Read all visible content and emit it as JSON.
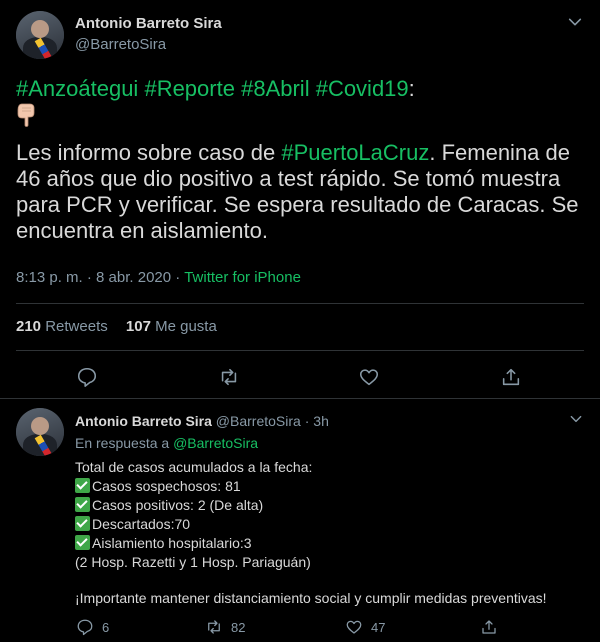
{
  "main_tweet": {
    "author_name": "Antonio Barreto Sira",
    "author_handle": "@BarretoSira",
    "hashtags_line": [
      "#Anzoátegui",
      "#Reporte",
      "#8Abril",
      "#Covid19"
    ],
    "hashtag_suffix": ":",
    "body_prefix": "Les informo sobre caso de ",
    "body_tag": "#PuertoLaCruz",
    "body_rest_1": ". Femenina de",
    "body_line_2": "46 años que dio positivo a test rápido. Se tomó muestra",
    "body_line_3": "para PCR y verificar. Se espera resultado de Caracas. Se",
    "body_line_4": "encuentra en aislamiento.",
    "time": "8:13 p. m.",
    "separator": "·",
    "date": "8 abr. 2020",
    "source": "Twitter for iPhone",
    "retweets_count": "210",
    "retweets_label": "Retweets",
    "likes_count": "107",
    "likes_label": "Me gusta"
  },
  "reply_tweet": {
    "author_name": "Antonio Barreto Sira",
    "author_handle": "@BarretoSira",
    "time_ago": "3h",
    "reply_prefix": "En respuesta a",
    "reply_handle": "@BarretoSira",
    "line_total": "Total de casos acumulados a la fecha:",
    "line_suspected": "Casos sospechosos: 81",
    "line_positive": "Casos positivos: 2 (De alta)",
    "line_discarded": "Descartados:70",
    "line_isolation": "Aislamiento hospitalario:3",
    "line_hospitals": "(2 Hosp. Razetti y 1 Hosp. Pariaguán)",
    "line_important": "¡Importante mantener distanciamiento social y cumplir medidas preventivas!",
    "replies": "6",
    "retweets": "82",
    "likes": "47"
  },
  "colors": {
    "background": "#000000",
    "hashtag": "#17bf63",
    "secondary": "#8899a6",
    "text": "#d9d9d9",
    "divider": "#2f3336"
  }
}
